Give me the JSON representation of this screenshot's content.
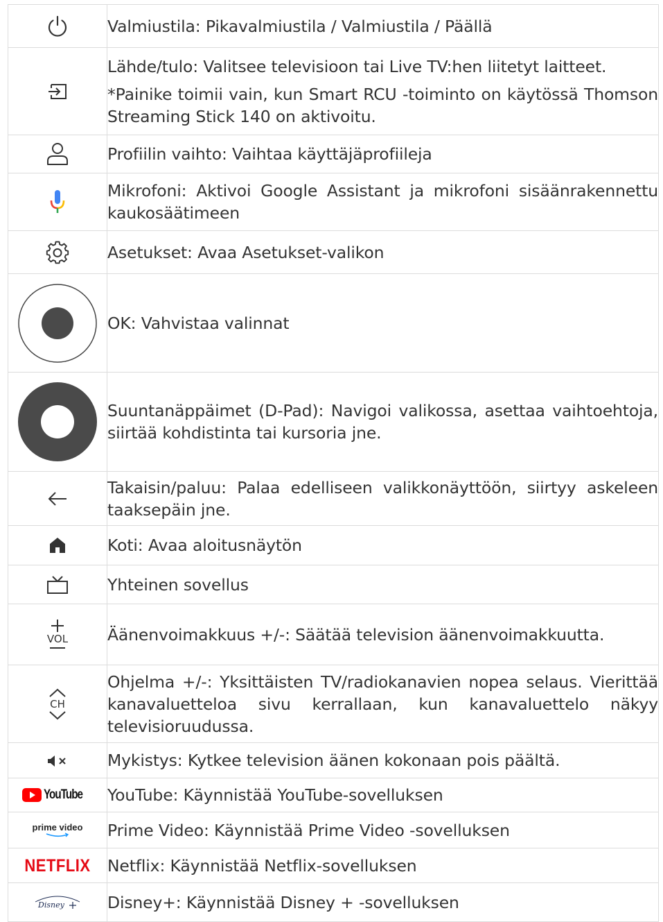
{
  "rows": [
    {
      "icon": "power-icon",
      "text": [
        "Valmiustila: Pikavalmiustila / Valmiustila / Päällä"
      ]
    },
    {
      "icon": "input-source-icon",
      "text": [
        "Lähde/tulo: Valitsee televisioon tai Live TV:hen liitetyt laitteet.",
        "*Painike toimii vain, kun Smart RCU -toiminto on käytössä Thomson Streaming Stick 140 on aktivoitu."
      ]
    },
    {
      "icon": "profile-icon",
      "text": [
        "Profiilin vaihto: Vaihtaa käyttäjäprofiileja"
      ]
    },
    {
      "icon": "microphone-icon",
      "text": [
        "Mikrofoni: Aktivoi Google Assistant ja mikrofoni sisäänrakennettu kaukosäätimeen"
      ]
    },
    {
      "icon": "settings-gear-icon",
      "text": [
        "Asetukset: Avaa Asetukset-valikon"
      ]
    },
    {
      "icon": "ok-button-icon",
      "text": [
        "OK: Vahvistaa valinnat"
      ]
    },
    {
      "icon": "dpad-icon",
      "text": [
        "Suuntanäppäimet (D-Pad): Navigoi valikossa, asettaa vaihtoehtoja, siirtää kohdistinta tai kursoria jne."
      ]
    },
    {
      "icon": "back-arrow-icon",
      "text": [
        "Takaisin/paluu: Palaa edelliseen valikkonäyttöön, siirtyy askeleen taaksepäin jne."
      ]
    },
    {
      "icon": "home-icon",
      "text": [
        "Koti: Avaa aloitusnäytön"
      ]
    },
    {
      "icon": "tv-icon",
      "text": [
        "Yhteinen sovellus"
      ]
    },
    {
      "icon": "volume-icon",
      "text": [
        "Äänenvoimakkuus +/-: Säätää television äänenvoimakkuutta."
      ]
    },
    {
      "icon": "channel-icon",
      "text": [
        "Ohjelma +/-: Yksittäisten TV/radiokanavien nopea selaus. Vierittää kanavaluetteloa sivu kerrallaan, kun kanavaluettelo näkyy televisioruudussa."
      ]
    },
    {
      "icon": "mute-icon",
      "text": [
        "Mykistys: Kytkee television äänen kokonaan pois päältä."
      ]
    },
    {
      "icon": "youtube-logo",
      "text": [
        "YouTube: Käynnistää YouTube-sovelluksen"
      ]
    },
    {
      "icon": "prime-video-logo",
      "text": [
        "Prime Video: Käynnistää Prime Video -sovelluksen"
      ]
    },
    {
      "icon": "netflix-logo",
      "text": [
        "Netflix: Käynnistää Netflix-sovelluksen"
      ]
    },
    {
      "icon": "disney-plus-logo",
      "text": [
        "Disney+: Käynnistää Disney + -sovelluksen"
      ]
    }
  ],
  "icon_labels": {
    "vol": "VOL",
    "ch": "CH",
    "youtube": "YouTube",
    "prime_line1": "prime video",
    "netflix": "NETFLIX",
    "disney": "Disney+"
  },
  "colors": {
    "border": "#dcdcdc",
    "text": "#333333",
    "netflix_red": "#e50914",
    "youtube_red": "#ff0000",
    "ok_dark": "#4a4a4a"
  }
}
